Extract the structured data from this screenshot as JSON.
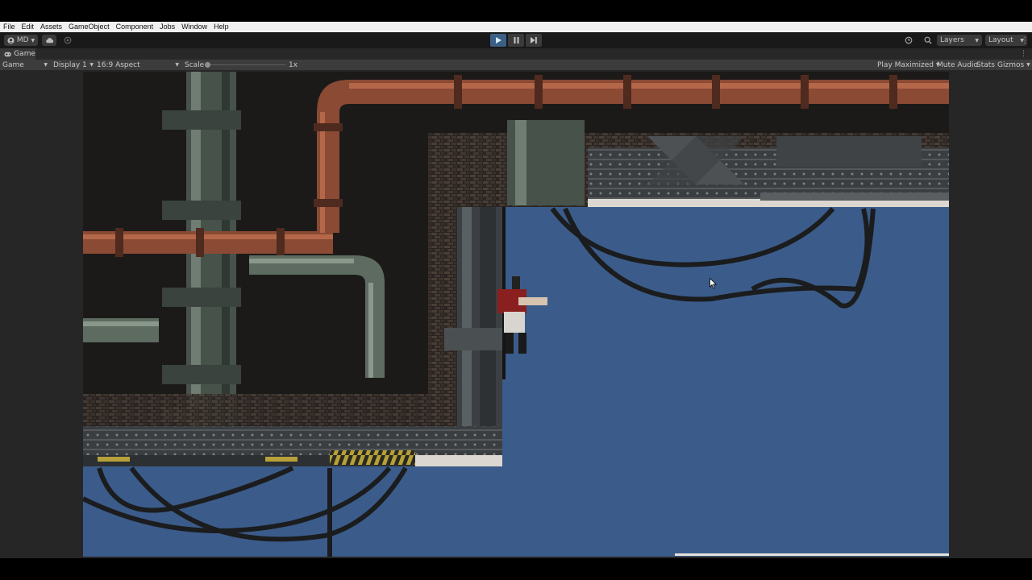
{
  "menu": {
    "file": "File",
    "edit": "Edit",
    "assets": "Assets",
    "gameobject": "GameObject",
    "component": "Component",
    "jobs": "Jobs",
    "window": "Window",
    "help": "Help"
  },
  "toolbar": {
    "account_label": "MD",
    "play_state": "playing",
    "layers_label": "Layers",
    "layout_label": "Layout"
  },
  "tab": {
    "title": "Game"
  },
  "game_toolbar": {
    "view_mode": "Game",
    "display": "Display 1",
    "aspect": "16:9 Aspect",
    "scale_label": "Scale",
    "scale_value": "1x",
    "play_mode": "Play Maximized",
    "mute_audio": "Mute Audio",
    "stats": "Stats",
    "gizmos": "Gizmos"
  },
  "colors": {
    "sky": "#3b5c8a",
    "play_active": "#3c5f86",
    "menubar_bg": "#f0f0f0"
  },
  "icons": [
    "account-icon",
    "cloud-icon",
    "collab-icon",
    "play-icon",
    "pause-icon",
    "step-icon",
    "history-icon",
    "search-icon",
    "more-icon",
    "gamepad-icon",
    "mouse-cursor-icon"
  ]
}
